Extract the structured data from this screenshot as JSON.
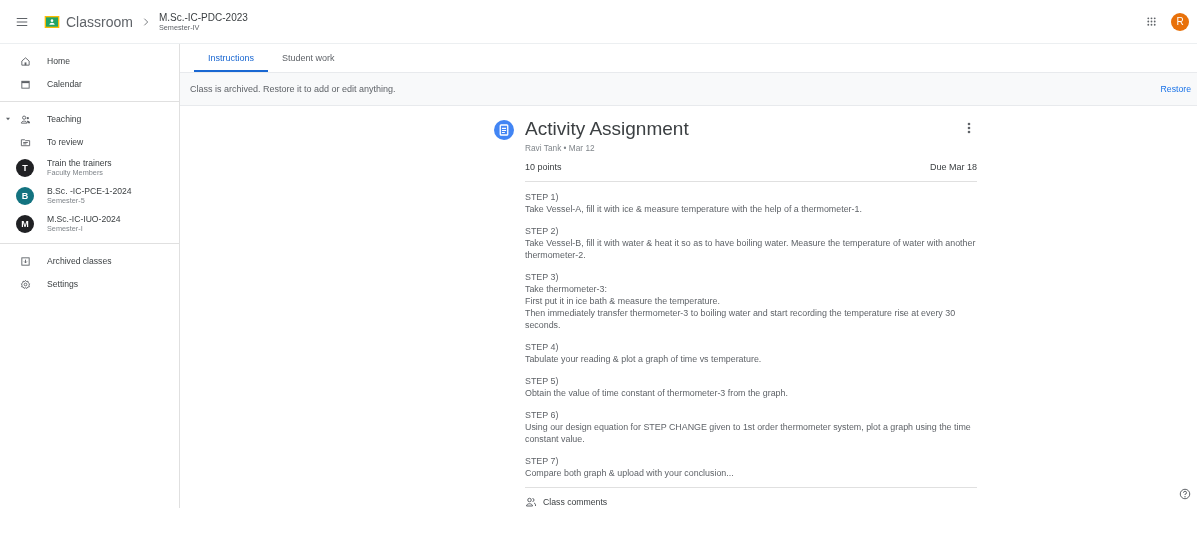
{
  "header": {
    "app_name": "Classroom",
    "class_name": "M.Sc.-IC-PDC-2023",
    "class_section": "Semester-IV",
    "account_initial": "R"
  },
  "sidebar": {
    "groups": [
      {
        "items": [
          {
            "kind": "home",
            "label": "Home",
            "selected": false
          },
          {
            "kind": "calendar",
            "label": "Calendar",
            "selected": false
          }
        ]
      },
      {
        "items": [
          {
            "kind": "teaching",
            "label": "Teaching",
            "expanded": true,
            "selected": false
          },
          {
            "kind": "review",
            "label": "To review",
            "selected": false
          },
          {
            "kind": "class",
            "label": "Train the trainers",
            "subtitle": "Faculty Members",
            "initial": "T",
            "color": "#202124",
            "selected": false
          },
          {
            "kind": "class",
            "label": "B.Sc. -IC-PCE-1-2024",
            "subtitle": "Semester-5",
            "initial": "B",
            "color": "#137380",
            "selected": false
          },
          {
            "kind": "class",
            "label": "M.Sc.-IC-IUO-2024",
            "subtitle": "Semester-I",
            "initial": "M",
            "color": "#202124",
            "selected": false
          }
        ]
      },
      {
        "items": [
          {
            "kind": "archive",
            "label": "Archived classes",
            "selected": false
          },
          {
            "kind": "settings",
            "label": "Settings",
            "selected": false
          }
        ]
      }
    ]
  },
  "tabs": [
    {
      "label": "Instructions",
      "selected": true
    },
    {
      "label": "Student work",
      "selected": false
    }
  ],
  "banner": {
    "message": "Class is archived. Restore it to add or edit anything.",
    "action": "Restore"
  },
  "assignment": {
    "title": "Activity Assignment",
    "meta": "Ravi Tank • Mar 12",
    "points": "10 points",
    "due": "Due Mar 18",
    "steps": [
      {
        "heading": "STEP 1)",
        "lines": [
          "Take Vessel-A, fill it with ice & measure temperature with the help of a thermometer-1."
        ]
      },
      {
        "heading": "STEP 2)",
        "lines": [
          "Take Vessel-B, fill it with water & heat it so as to have boiling water. Measure the temperature of water with another thermometer-2."
        ]
      },
      {
        "heading": "STEP 3)",
        "lines": [
          "Take thermometer-3:",
          "First put it in ice bath & measure the temperature.",
          "Then immediately transfer thermometer-3 to boiling water and start recording the temperature rise at every 30 seconds."
        ]
      },
      {
        "heading": "STEP 4)",
        "lines": [
          "Tabulate your reading & plot a graph of time vs temperature."
        ]
      },
      {
        "heading": "STEP 5)",
        "lines": [
          "Obtain the value of time constant of thermometer-3 from the graph."
        ]
      },
      {
        "heading": "STEP 6)",
        "lines": [
          "Using our design equation for STEP CHANGE given to 1st order thermometer system, plot a graph using the time constant value."
        ]
      },
      {
        "heading": "STEP 7)",
        "lines": [
          "Compare both graph & upload with your conclusion..."
        ]
      }
    ],
    "comments_label": "Class comments"
  }
}
